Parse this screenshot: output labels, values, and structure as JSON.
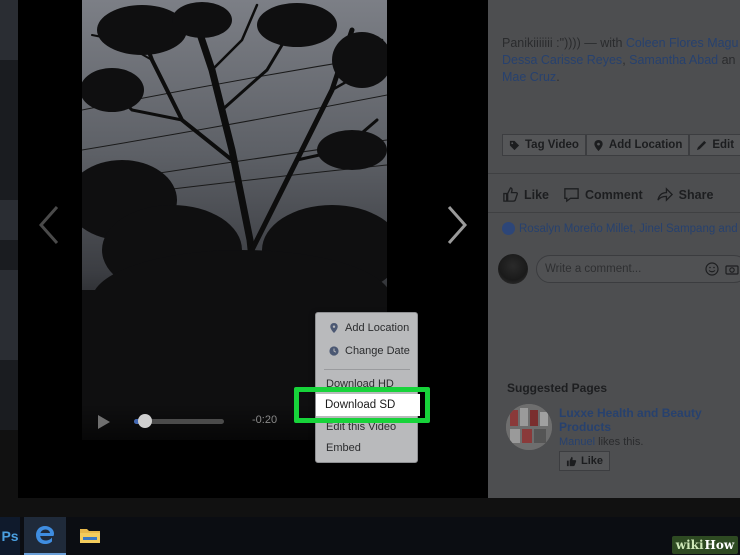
{
  "caption": {
    "text": "Panikiiiiiii :\")))) ",
    "with_prefix": "— with ",
    "tagged_line1": "Coleen Flores Magu",
    "tagged_line2_a": "Dessa Carisse Reyes",
    "tagged_sep": ", ",
    "tagged_line2_b": "Samantha Abad",
    "tagged_line2_end": " an",
    "tagged_line3": "Mae Cruz",
    "period": "."
  },
  "panel_actions": {
    "tag_video": "Tag Video",
    "add_location": "Add Location",
    "edit": "Edit"
  },
  "reactions": {
    "like": "Like",
    "comment": "Comment",
    "share": "Share"
  },
  "likers_text": "Rosalyn Moreño Millet, Jinel Sampang and 17",
  "comment_input": {
    "placeholder": "Write a comment..."
  },
  "suggested": {
    "title": "Suggested Pages",
    "page_name": "Luxxe Health and Beauty Products",
    "friend": "Manuel",
    "likes_suffix": " likes this.",
    "like_button": "Like"
  },
  "video": {
    "time": "-0:20",
    "progress": 0.12
  },
  "menu": {
    "add_location": "Add Location",
    "change_date": "Change Date",
    "download_hd": "Download HD",
    "download_sd": "Download SD",
    "edit_video": "Edit this Video",
    "embed": "Embed"
  },
  "taskbar": {
    "ps_label": "Ps"
  },
  "watermark": {
    "part1": "wiki",
    "part2": "How"
  },
  "colors": {
    "highlight": "#17d33a",
    "accent": "#4267b2"
  }
}
